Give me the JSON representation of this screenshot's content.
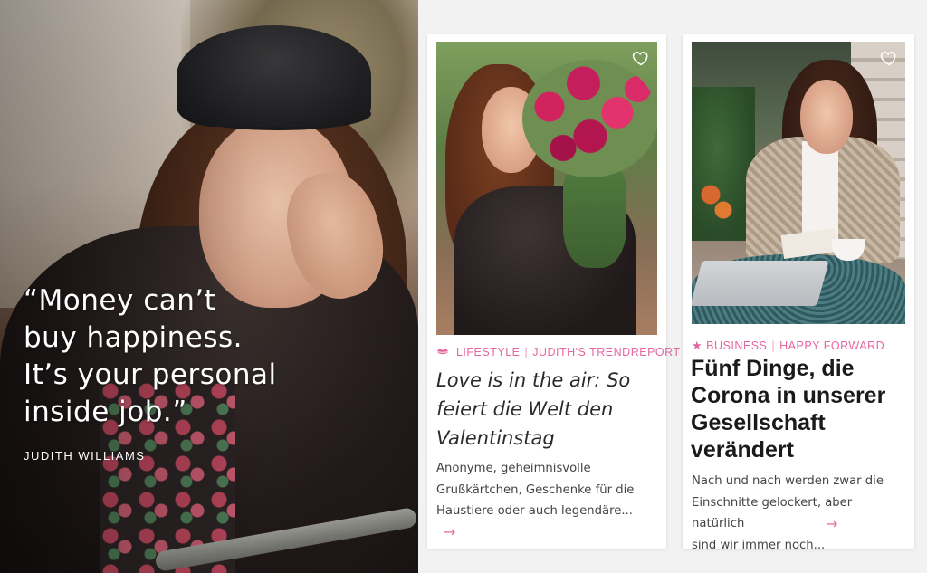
{
  "hero": {
    "quote_lines": [
      "“Money can’t",
      "buy happiness.",
      "It’s your personal",
      "inside job.”"
    ],
    "author": "JUDITH WILLIAMS"
  },
  "cards": [
    {
      "categories": [
        "LIFESTYLE",
        "JUDITH'S TRENDREPORT"
      ],
      "category_icon": "lips-icon",
      "title_lines": [
        "Love is in the air: So",
        "feiert die Welt den",
        "Valentinstag"
      ],
      "excerpt_lines": [
        "Anonyme, geheimnisvolle",
        "Grußkärtchen, Geschenke für die",
        "Haustiere oder auch legendäre..."
      ],
      "more_icon": "→"
    },
    {
      "categories": [
        "BUSINESS",
        "HAPPY FORWARD"
      ],
      "category_icon": "star-icon",
      "title_lines": [
        "Fünf Dinge, die",
        "Corona in unserer",
        "Gesellschaft",
        "verändert"
      ],
      "excerpt_lines": [
        "Nach und nach werden zwar die",
        "Einschnitte gelockert, aber natürlich",
        "sind wir immer noch..."
      ],
      "more_icon": "→"
    }
  ],
  "colors": {
    "accent": "#e6679f",
    "card_bg": "#ffffff",
    "page_bg": "#f2f2f2"
  }
}
